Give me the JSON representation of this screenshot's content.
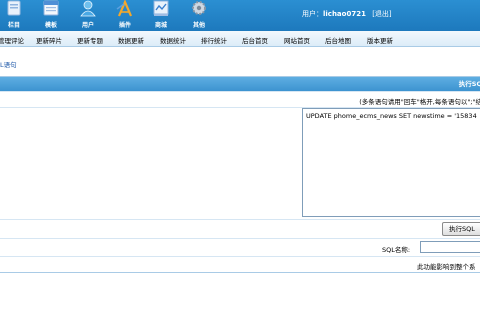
{
  "topnav": {
    "items": [
      {
        "label": "栏目",
        "icon": "columns-icon"
      },
      {
        "label": "模板",
        "icon": "template-icon"
      },
      {
        "label": "用户",
        "icon": "user-icon"
      },
      {
        "label": "插件",
        "icon": "plugin-icon"
      },
      {
        "label": "商城",
        "icon": "shop-icon"
      },
      {
        "label": "其他",
        "icon": "gear-icon"
      }
    ],
    "user_prefix": "用户：",
    "username": "lichao0721",
    "logout": "[退出]"
  },
  "menu": [
    "管理评论",
    "更新碎片",
    "更新专题",
    "数据更新",
    "数据统计",
    "排行统计",
    "后台首页",
    "网站首页",
    "后台地图",
    "版本更新"
  ],
  "breadcrumb": "L语句",
  "panel": {
    "title": "执行SQ",
    "hint": "(多条语句请用\"回车\"格开,每条语句以\";\"结",
    "sql_value": "UPDATE phome_ecms_news SET newstime = '15834",
    "execute_button": "执行SQL",
    "sql_name_label": "SQL名称:",
    "note": "此功能影响到整个系"
  },
  "colors": {
    "header": "#1d79bd",
    "menu_bg": "#dcecf8",
    "table_head": "#3d93d0"
  }
}
